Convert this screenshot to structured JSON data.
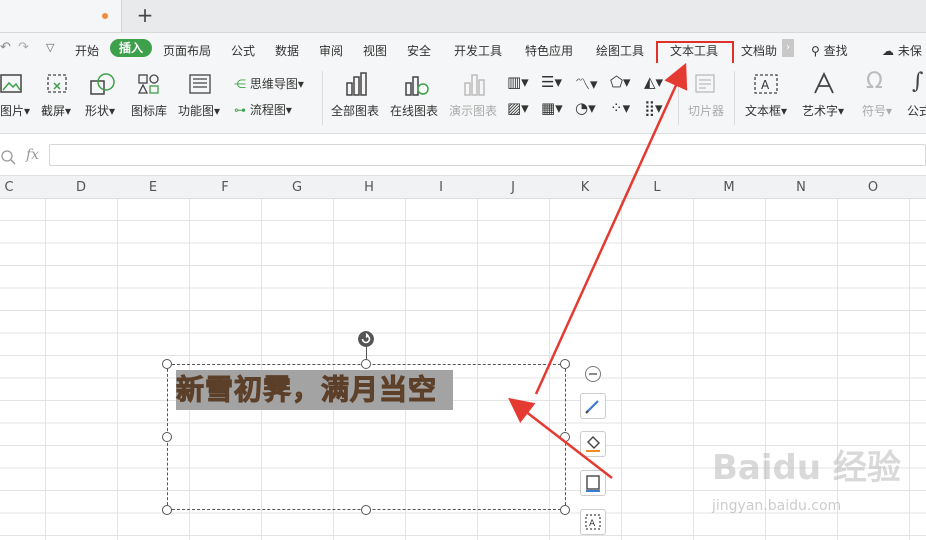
{
  "tabs": {
    "new_tab_symbol": "+"
  },
  "menu": {
    "items": [
      "开始",
      "插入",
      "页面布局",
      "公式",
      "数据",
      "审阅",
      "视图",
      "安全",
      "开发工具",
      "特色应用",
      "绘图工具",
      "文本工具",
      "文档助"
    ],
    "search_label": "查找",
    "unsaved_label": "未保",
    "more_symbol": "›"
  },
  "ribbon": {
    "picture": "图片",
    "screenshot": "截屏",
    "shape": "形状",
    "icon_lib": "图标库",
    "func_chart": "功能图",
    "mindmap": "思维导图",
    "flowchart": "流程图",
    "all_charts": "全部图表",
    "online_charts": "在线图表",
    "demo_charts": "演示图表",
    "slicer": "切片器",
    "textbox": "文本框",
    "wordart": "艺术字",
    "symbol": "符号",
    "formula": "公式"
  },
  "formula_bar": {
    "fx_label": "fx",
    "value": ""
  },
  "columns": [
    "C",
    "D",
    "E",
    "F",
    "G",
    "H",
    "I",
    "J",
    "K",
    "L",
    "M",
    "N",
    "O"
  ],
  "textbox": {
    "text": "新雪初霁，满月当空"
  },
  "watermark": {
    "brand": "Baidu 经验",
    "url": "jingyan.baidu.com"
  },
  "colors": {
    "accent_green": "#3ea04a",
    "highlight_red": "#e0302a",
    "arrow_red": "#e53a31"
  }
}
